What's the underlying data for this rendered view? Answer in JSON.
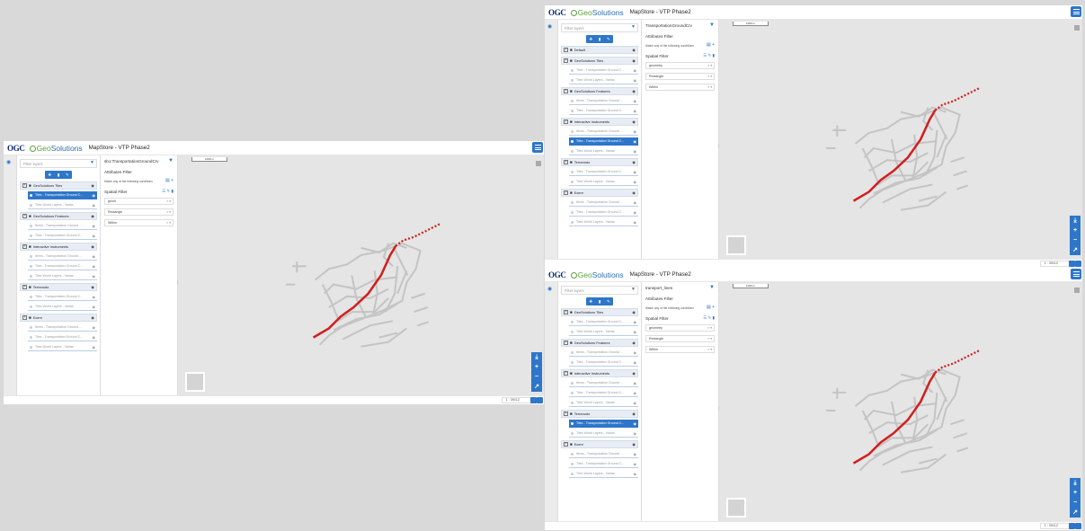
{
  "app": {
    "ogc": "OGC",
    "geo_prefix": "Geo",
    "geo_suffix": "Solutions",
    "title": "MapStore - VTP Phase2"
  },
  "filter_placeholder": "Filter layers",
  "attributes_filter": "Attributes Filter",
  "match_text": "Match any of the following conditions",
  "spatial_filter": "Spatial Filter",
  "scale_bar": "1000 m",
  "windows": [
    {
      "id": "left",
      "panel_title": "sb1:TransportationGroundCrv",
      "selects": [
        "geom",
        "Rectangle",
        "Within"
      ],
      "scale": "1 : 39112",
      "tree": [
        {
          "t": "g",
          "label": "GeoSolutions Tiles"
        },
        {
          "t": "l",
          "label": "Tiles - Transportation Ground C...",
          "sel": true
        },
        {
          "t": "l",
          "label": "Tiles World Layers - Varias"
        },
        {
          "t": "g",
          "label": "GeoSolutions Features"
        },
        {
          "t": "l",
          "label": "Items - Transportation Ground ..."
        },
        {
          "t": "l",
          "label": "Tiles - Transportation Ground C..."
        },
        {
          "t": "g",
          "label": "Interactive Instruments"
        },
        {
          "t": "l",
          "label": "Items - Transportation Ground ..."
        },
        {
          "t": "l",
          "label": "Tiles - Transportation Ground C..."
        },
        {
          "t": "l",
          "label": "Tiles World Layers - Varias"
        },
        {
          "t": "g",
          "label": "Terranodo"
        },
        {
          "t": "l",
          "label": "Tiles - Transportation Ground C..."
        },
        {
          "t": "l",
          "label": "Tiles World Layers - Varias"
        },
        {
          "t": "g",
          "label": "Ecere"
        },
        {
          "t": "l",
          "label": "Items - Transportation Ground ..."
        },
        {
          "t": "l",
          "label": "Tiles - Transportation Ground C..."
        },
        {
          "t": "l",
          "label": "Tiles World Layers - Varias"
        }
      ]
    },
    {
      "id": "tr",
      "panel_title": "TransportationGroundCrv",
      "selects": [
        "geometry",
        "Rectangle",
        "Within"
      ],
      "scale": "1 : 39112",
      "tree": [
        {
          "t": "g",
          "label": "Default"
        },
        {
          "t": "g",
          "label": "GeoSolutions Tiles"
        },
        {
          "t": "l",
          "label": "Tiles - Transportation Ground C..."
        },
        {
          "t": "l",
          "label": "Tiles World Layers - Varias"
        },
        {
          "t": "g",
          "label": "GeoSolutions Features"
        },
        {
          "t": "l",
          "label": "Items - Transportation Ground ..."
        },
        {
          "t": "l",
          "label": "Tiles - Transportation Ground C..."
        },
        {
          "t": "g",
          "label": "Interactive Instruments"
        },
        {
          "t": "l",
          "label": "Items - Transportation Ground ..."
        },
        {
          "t": "l",
          "label": "Tiles - Transportation Ground C...",
          "sel": true
        },
        {
          "t": "l",
          "label": "Tiles World Layers - Varias"
        },
        {
          "t": "g",
          "label": "Terranodo"
        },
        {
          "t": "l",
          "label": "Tiles - Transportation Ground C..."
        },
        {
          "t": "l",
          "label": "Tiles World Layers - Varias"
        },
        {
          "t": "g",
          "label": "Ecere"
        },
        {
          "t": "l",
          "label": "Items - Transportation Ground ..."
        },
        {
          "t": "l",
          "label": "Tiles - Transportation Ground C..."
        },
        {
          "t": "l",
          "label": "Tiles World Layers - Varias"
        }
      ]
    },
    {
      "id": "br",
      "panel_title": "transport_lines",
      "selects": [
        "geometry",
        "Rectangle",
        "Within"
      ],
      "scale": "1 : 39112",
      "tree": [
        {
          "t": "g",
          "label": "GeoSolutions Tiles"
        },
        {
          "t": "l",
          "label": "Tiles - Transportation Ground C..."
        },
        {
          "t": "l",
          "label": "Tiles World Layers - Varias"
        },
        {
          "t": "g",
          "label": "GeoSolutions Features"
        },
        {
          "t": "l",
          "label": "Items - Transportation Ground ..."
        },
        {
          "t": "l",
          "label": "Tiles - Transportation Ground C..."
        },
        {
          "t": "g",
          "label": "Interactive Instruments"
        },
        {
          "t": "l",
          "label": "Items - Transportation Ground ..."
        },
        {
          "t": "l",
          "label": "Tiles - Transportation Ground C..."
        },
        {
          "t": "l",
          "label": "Tiles World Layers - Varias"
        },
        {
          "t": "g",
          "label": "Terranodo"
        },
        {
          "t": "l",
          "label": "Tiles - Transportation Ground C...",
          "sel": true
        },
        {
          "t": "l",
          "label": "Tiles World Layers - Varias"
        },
        {
          "t": "g",
          "label": "Ecere"
        },
        {
          "t": "l",
          "label": "Items - Transportation Ground ..."
        },
        {
          "t": "l",
          "label": "Tiles - Transportation Ground C..."
        },
        {
          "t": "l",
          "label": "Tiles World Layers - Varias"
        }
      ]
    }
  ]
}
